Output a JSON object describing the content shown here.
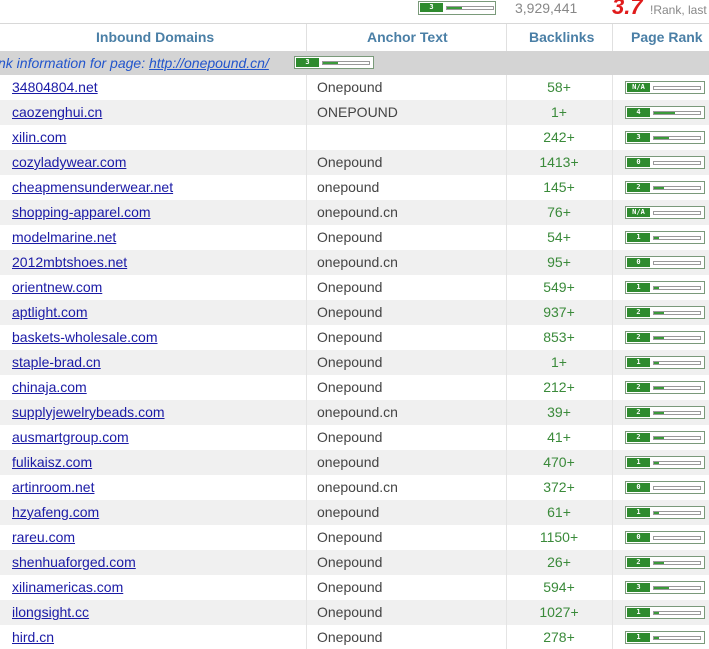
{
  "top": {
    "pagerank": {
      "label": "3",
      "fill": 0.33
    },
    "count": "3,929,441",
    "score": "3.7",
    "rank_text": "!Rank, last"
  },
  "headers": {
    "domains": "Inbound Domains",
    "anchor": "Anchor Text",
    "backlinks": "Backlinks",
    "pagerank": "Page Rank"
  },
  "info": {
    "prefix": "nk information for page: ",
    "url": "http://onepound.cn/",
    "pagerank": {
      "label": "3",
      "fill": 0.33
    }
  },
  "rows": [
    {
      "domain": "34804804.net",
      "anchor": "Onepound",
      "backlinks": "58+",
      "pr": "N/A",
      "fill": 0.0
    },
    {
      "domain": "caozenghui.cn",
      "anchor": "ONEPOUND",
      "backlinks": "1+",
      "pr": "4",
      "fill": 0.45
    },
    {
      "domain": "xilin.com",
      "anchor": "",
      "backlinks": "242+",
      "pr": "3",
      "fill": 0.33
    },
    {
      "domain": "cozyladywear.com",
      "anchor": "Onepound",
      "backlinks": "1413+",
      "pr": "0",
      "fill": 0.0
    },
    {
      "domain": "cheapmensunderwear.net",
      "anchor": "onepound",
      "backlinks": "145+",
      "pr": "2",
      "fill": 0.22
    },
    {
      "domain": "shopping-apparel.com",
      "anchor": "onepound.cn",
      "backlinks": "76+",
      "pr": "N/A",
      "fill": 0.0
    },
    {
      "domain": "modelmarine.net",
      "anchor": "Onepound",
      "backlinks": "54+",
      "pr": "1",
      "fill": 0.1
    },
    {
      "domain": "2012mbtshoes.net",
      "anchor": "onepound.cn",
      "backlinks": "95+",
      "pr": "0",
      "fill": 0.0
    },
    {
      "domain": "orientnew.com",
      "anchor": "Onepound",
      "backlinks": "549+",
      "pr": "1",
      "fill": 0.1
    },
    {
      "domain": "aptlight.com",
      "anchor": "Onepound",
      "backlinks": "937+",
      "pr": "2",
      "fill": 0.22
    },
    {
      "domain": "baskets-wholesale.com",
      "anchor": "Onepound",
      "backlinks": "853+",
      "pr": "2",
      "fill": 0.22
    },
    {
      "domain": "staple-brad.cn",
      "anchor": "Onepound",
      "backlinks": "1+",
      "pr": "1",
      "fill": 0.1
    },
    {
      "domain": "chinaja.com",
      "anchor": "Onepound",
      "backlinks": "212+",
      "pr": "2",
      "fill": 0.22
    },
    {
      "domain": "supplyjewelrybeads.com",
      "anchor": "onepound.cn",
      "backlinks": "39+",
      "pr": "2",
      "fill": 0.22
    },
    {
      "domain": "ausmartgroup.com",
      "anchor": "Onepound",
      "backlinks": "41+",
      "pr": "2",
      "fill": 0.22
    },
    {
      "domain": "fulikaisz.com",
      "anchor": "onepound",
      "backlinks": "470+",
      "pr": "1",
      "fill": 0.1
    },
    {
      "domain": "artinroom.net",
      "anchor": "onepound.cn",
      "backlinks": "372+",
      "pr": "0",
      "fill": 0.0
    },
    {
      "domain": "hzyafeng.com",
      "anchor": "onepound",
      "backlinks": "61+",
      "pr": "1",
      "fill": 0.1
    },
    {
      "domain": "rareu.com",
      "anchor": "Onepound",
      "backlinks": "1150+",
      "pr": "0",
      "fill": 0.0
    },
    {
      "domain": "shenhuaforged.com",
      "anchor": "Onepound",
      "backlinks": "26+",
      "pr": "2",
      "fill": 0.22
    },
    {
      "domain": "xilinamericas.com",
      "anchor": "Onepound",
      "backlinks": "594+",
      "pr": "3",
      "fill": 0.33
    },
    {
      "domain": "ilongsight.cc",
      "anchor": "Onepound",
      "backlinks": "1027+",
      "pr": "1",
      "fill": 0.1
    },
    {
      "domain": "hird.cn",
      "anchor": "Onepound",
      "backlinks": "278+",
      "pr": "1",
      "fill": 0.1
    }
  ]
}
